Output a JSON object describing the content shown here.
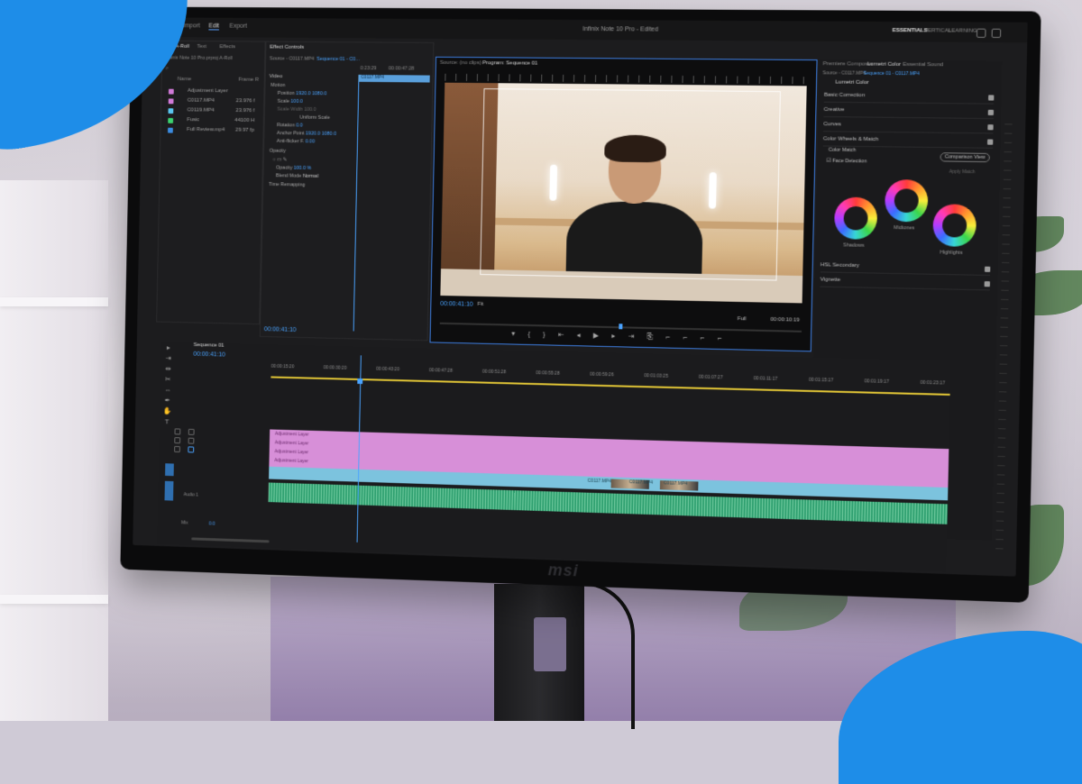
{
  "workspace_tabs": [
    "Import",
    "Edit",
    "Export"
  ],
  "active_workspace": "Edit",
  "window_title": "Infinix Note 10 Pro - Edited",
  "workspace_presets": [
    "ESSENTIALS",
    "VERTICAL",
    "LEARNING"
  ],
  "project_panel": {
    "tabs": [
      "Inv. A-Roll",
      "Text",
      "Effects"
    ],
    "path": "Infinix Note 10 Pro.prproj A-Roll",
    "columns": {
      "name": "Name",
      "fps": "Frame R"
    },
    "items": [
      {
        "name": "Adjustment Layer",
        "fps": "",
        "color": "#d07ad8"
      },
      {
        "name": "C0117.MP4",
        "fps": "23.976 f",
        "color": "#d07ad8"
      },
      {
        "name": "C0119.MP4",
        "fps": "23.976 f",
        "color": "#5ac6f0"
      },
      {
        "name": "Fusic",
        "fps": "44100 H",
        "color": "#3bd36f"
      },
      {
        "name": "Full Review.mp4",
        "fps": "29.97 fp",
        "color": "#3b8be0"
      }
    ]
  },
  "effect_controls": {
    "tab": "Effect Controls",
    "source": "Source - C0117.MP4",
    "sequence": "Sequence 01 - C0...",
    "clip_label": "C0117.MP4",
    "time_start": "0:23:29",
    "time_end": "00:00:47:28",
    "section_video": "Video",
    "rows": [
      {
        "label": "Motion",
        "value": ""
      },
      {
        "label": "Position",
        "value": "1920.0   1080.0"
      },
      {
        "label": "Scale",
        "value": "100.0"
      },
      {
        "label": "Scale Width",
        "value": "100.0"
      },
      {
        "label": "Uniform Scale",
        "value": ""
      },
      {
        "label": "Rotation",
        "value": "0.0"
      },
      {
        "label": "Anchor Point",
        "value": "1920.0   1080.0"
      },
      {
        "label": "Anti-flicker F.",
        "value": "0.00"
      },
      {
        "label": "Opacity",
        "value": ""
      },
      {
        "label": "Opacity",
        "value": "100.0 %"
      },
      {
        "label": "Blend Mode",
        "value": "Normal"
      },
      {
        "label": "Time Remapping",
        "value": ""
      }
    ],
    "current_time": "00:00:41:10"
  },
  "program_monitor": {
    "source_tab": "Source: (no clips)",
    "program_tab": "Program: Sequence 01",
    "timecode": "00:00:41:10",
    "fit": "Fit",
    "resolution": "Full",
    "duration": "00:00:10:19"
  },
  "lumetri": {
    "tabs": [
      "Premiere Composer",
      "Lumetri Color",
      "Essential Sound"
    ],
    "source": "Source - C0117.MP4",
    "sequence": "Sequence 01 - C0117.MP4",
    "heading": "Lumetri Color",
    "sections": [
      "Basic Correction",
      "Creative",
      "Curves",
      "Color Wheels & Match",
      "HSL Secondary",
      "Vignette"
    ],
    "color_match": "Color Match",
    "comparison_view": "Comparison View",
    "face_detection": "Face Detection",
    "apply_match": "Apply Match",
    "wheels": [
      "Shadows",
      "Midtones",
      "Highlights"
    ]
  },
  "timeline": {
    "tab": "Sequence 01",
    "timecode": "00:00:41:10",
    "ruler": [
      "00:00:15:20",
      "00:00:30:20",
      "00:00:43:20",
      "00:00:47:28",
      "00:00:51:28",
      "00:00:55:28",
      "00:00:59:26",
      "00:01:03:25",
      "00:01:07:27",
      "00:01:11:17",
      "00:01:15:17",
      "00:01:19:17",
      "00:01:23:17"
    ],
    "adjustment_label": "Adjustment Layer",
    "clips": [
      "C0117.MP4",
      "C0117.MP4",
      "C0117.MP4"
    ],
    "audio_label": "Audio 1",
    "mix_label": "Mix",
    "mix_value": "0.0"
  },
  "brand": "msi"
}
